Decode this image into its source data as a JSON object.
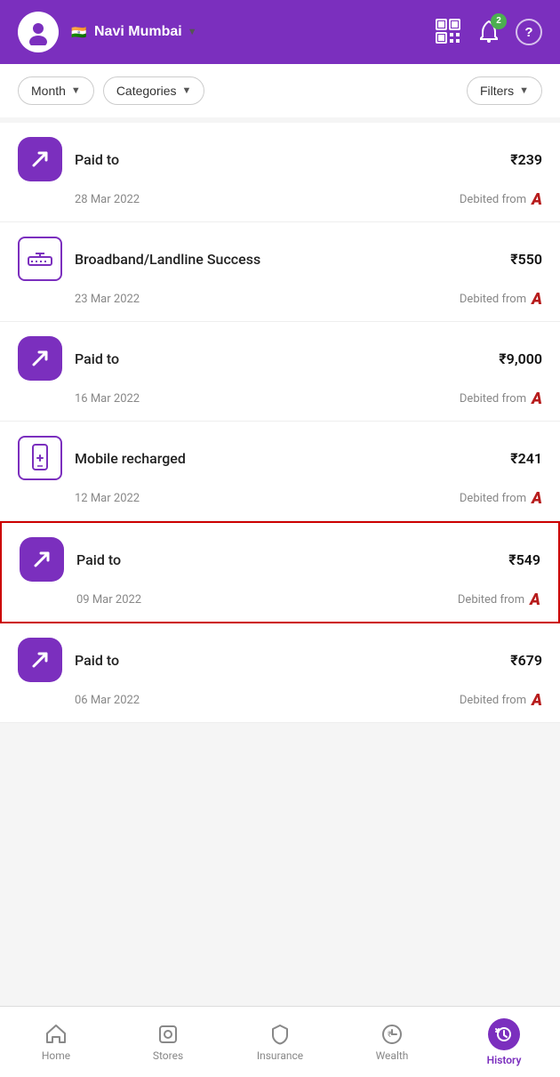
{
  "header": {
    "location": "Navi Mumbai",
    "notification_count": "2",
    "qr_label": "QR",
    "help_label": "?"
  },
  "filters": {
    "month_label": "Month",
    "categories_label": "Categories",
    "filters_label": "Filters"
  },
  "transactions": [
    {
      "id": 1,
      "type": "upi",
      "title": "Paid to",
      "amount": "₹239",
      "date": "28 Mar 2022",
      "debit_label": "Debited from",
      "highlighted": false
    },
    {
      "id": 2,
      "type": "broadband",
      "title": "Broadband/Landline Success",
      "amount": "₹550",
      "date": "23 Mar 2022",
      "debit_label": "Debited from",
      "highlighted": false
    },
    {
      "id": 3,
      "type": "upi",
      "title": "Paid to",
      "amount": "₹9,000",
      "date": "16 Mar 2022",
      "debit_label": "Debited from",
      "highlighted": false
    },
    {
      "id": 4,
      "type": "mobile",
      "title": "Mobile recharged",
      "amount": "₹241",
      "date": "12 Mar 2022",
      "debit_label": "Debited from",
      "highlighted": false
    },
    {
      "id": 5,
      "type": "upi",
      "title": "Paid to",
      "amount": "₹549",
      "date": "09 Mar 2022",
      "debit_label": "Debited from",
      "highlighted": true
    },
    {
      "id": 6,
      "type": "upi",
      "title": "Paid to",
      "amount": "₹679",
      "date": "06 Mar 2022",
      "debit_label": "Debited from",
      "highlighted": false
    }
  ],
  "bottom_nav": {
    "home": "Home",
    "stores": "Stores",
    "insurance": "Insurance",
    "wealth": "Wealth",
    "history": "History"
  }
}
